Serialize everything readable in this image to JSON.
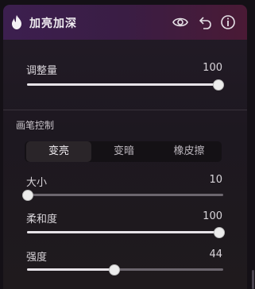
{
  "panel": {
    "title": "加亮加深",
    "icons": [
      "flame-icon",
      "eye-icon",
      "undo-icon",
      "info-icon"
    ]
  },
  "adjustment": {
    "label": "调整量",
    "value": "100",
    "fraction": 1.0
  },
  "brush": {
    "section_title": "画笔控制",
    "modes": [
      {
        "label": "变亮",
        "active": true
      },
      {
        "label": "变暗",
        "active": false
      },
      {
        "label": "橡皮擦",
        "active": false
      }
    ],
    "size": {
      "label": "大小",
      "value": "10",
      "fraction": 0.0
    },
    "softness": {
      "label": "柔和度",
      "value": "100",
      "fraction": 1.0
    },
    "strength": {
      "label": "强度",
      "value": "44",
      "fraction": 0.44
    }
  },
  "colors": {
    "accent": "#ffffff",
    "header_gradient_start": "#3c1f4f",
    "header_gradient_end": "#4a1a35"
  }
}
